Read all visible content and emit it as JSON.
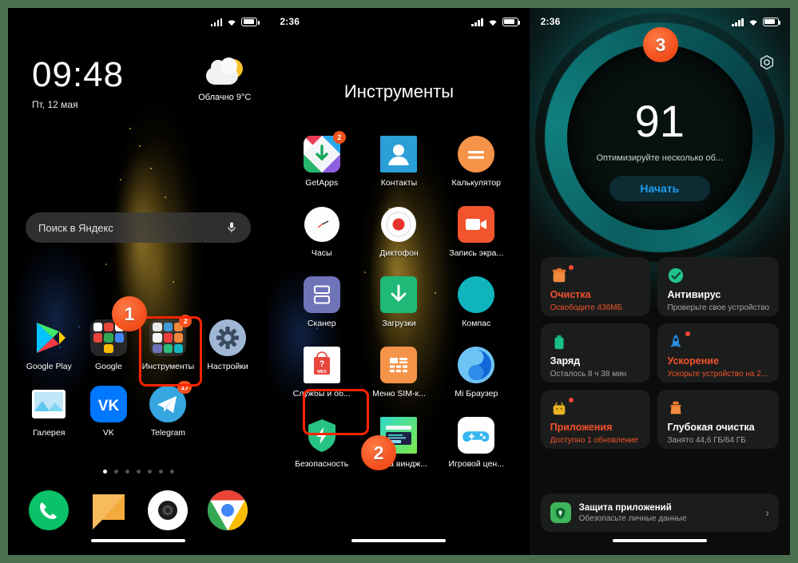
{
  "frame": {
    "border_color": "#4a7050"
  },
  "panel_left": {
    "statusbar": {
      "time": "",
      "icons": [
        "signal-icon",
        "wifi-icon",
        "battery-icon"
      ]
    },
    "lockscreen": {
      "time": "09:48",
      "date": "Пт, 12 мая",
      "weather_condition": "Облачно",
      "weather_temp": "9°C",
      "weather_line": "Облачно  9°C"
    },
    "search": {
      "placeholder": "Поиск в Яндекс",
      "mic_icon": "microphone-icon"
    },
    "apps": [
      {
        "label": "Google Play",
        "icon": "google-play-icon",
        "badge": ""
      },
      {
        "label": "Google",
        "icon": "google-folder-icon",
        "badge": ""
      },
      {
        "label": "Инструменты",
        "icon": "tools-folder-icon",
        "badge": "2"
      },
      {
        "label": "Настройки",
        "icon": "settings-gear-icon",
        "badge": ""
      },
      {
        "label": "Галерея",
        "icon": "gallery-icon",
        "badge": ""
      },
      {
        "label": "VK",
        "icon": "vk-icon",
        "badge": ""
      },
      {
        "label": "Telegram",
        "icon": "telegram-icon",
        "badge": "17"
      }
    ],
    "page_dots": {
      "count": 7,
      "active_index": 0
    },
    "dock": [
      {
        "label": "",
        "icon": "phone-icon"
      },
      {
        "label": "",
        "icon": "messages-icon"
      },
      {
        "label": "",
        "icon": "camera-icon"
      },
      {
        "label": "",
        "icon": "chrome-icon"
      }
    ]
  },
  "panel_middle": {
    "statusbar": {
      "time": "2:36",
      "icons": [
        "signal-icon",
        "wifi-icon",
        "battery-icon"
      ]
    },
    "folder_title": "Инструменты",
    "apps": [
      {
        "label": "GetApps",
        "icon": "getapps-icon",
        "badge": "2"
      },
      {
        "label": "Контакты",
        "icon": "contacts-icon",
        "badge": ""
      },
      {
        "label": "Калькулятор",
        "icon": "calculator-icon",
        "badge": ""
      },
      {
        "label": "Часы",
        "icon": "clock-icon",
        "badge": ""
      },
      {
        "label": "Диктофон",
        "icon": "recorder-icon",
        "badge": ""
      },
      {
        "label": "Запись экра...",
        "icon": "screen-recorder-icon",
        "badge": ""
      },
      {
        "label": "Сканер",
        "icon": "scanner-icon",
        "badge": ""
      },
      {
        "label": "Загрузки",
        "icon": "downloads-icon",
        "badge": ""
      },
      {
        "label": "Компас",
        "icon": "compass-icon",
        "badge": ""
      },
      {
        "label": "Службы и об...",
        "icon": "miui-services-icon",
        "badge": ""
      },
      {
        "label": "Меню SIM-к...",
        "icon": "sim-menu-icon",
        "badge": ""
      },
      {
        "label": "Mi Браузер",
        "icon": "mi-browser-icon",
        "badge": ""
      },
      {
        "label": "Безопасность",
        "icon": "security-shield-icon",
        "badge": ""
      },
      {
        "label": "Лента виндж...",
        "icon": "widget-feed-icon",
        "badge": ""
      },
      {
        "label": "Игровой цен...",
        "icon": "game-center-icon",
        "badge": ""
      }
    ]
  },
  "panel_right": {
    "statusbar": {
      "time": "2:36",
      "icons": [
        "signal-icon",
        "wifi-icon",
        "battery-icon"
      ]
    },
    "settings_icon": "gear-icon",
    "score": "91",
    "score_subtitle": "Оптимизируйте несколько об...",
    "scan_button": "Начать",
    "cards": [
      {
        "title": "Очистка",
        "desc": "Освободите 436МБ",
        "icon": "trash-icon",
        "alert": true,
        "dot": true
      },
      {
        "title": "Антивирус",
        "desc": "Проверьте свое устройство",
        "icon": "shield-check-icon",
        "alert": false,
        "dot": false
      },
      {
        "title": "Заряд",
        "desc": "Осталось 8 ч 38 мин",
        "icon": "battery-card-icon",
        "alert": false,
        "dot": false
      },
      {
        "title": "Ускорение",
        "desc": "Ускорьте устройство на 2...",
        "icon": "rocket-icon",
        "alert": true,
        "dot": true
      },
      {
        "title": "Приложения",
        "desc": "Доступно 1 обновление",
        "icon": "apps-box-icon",
        "alert": true,
        "dot": true
      },
      {
        "title": "Глубокая очистка",
        "desc": "Занято 44,6 ГБ/64 ГБ",
        "icon": "broom-icon",
        "alert": false,
        "dot": false
      }
    ],
    "wide_card": {
      "title": "Защита приложений",
      "subtitle": "Обезопасьте личные данные",
      "icon": "app-lock-icon",
      "chevron": "chevron-right-icon"
    }
  },
  "annotations": {
    "steps": [
      {
        "label": "1",
        "target": "tools-folder-app"
      },
      {
        "label": "2",
        "target": "security-app"
      },
      {
        "label": "3",
        "target": "security-app-screen"
      }
    ],
    "highlight_color": "#ff2400"
  }
}
